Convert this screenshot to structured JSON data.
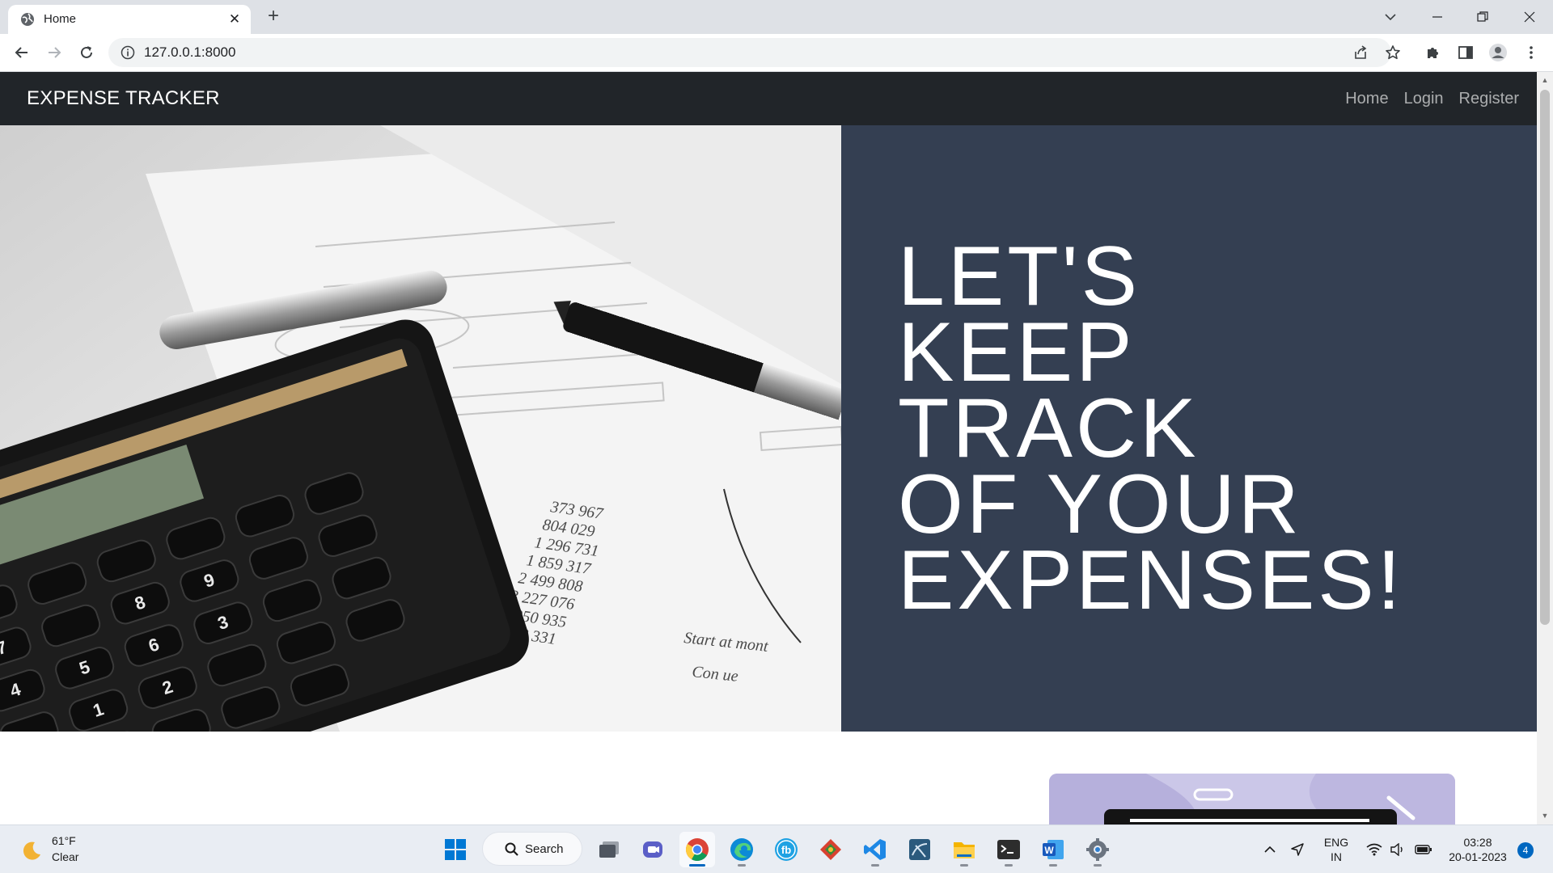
{
  "browser": {
    "tab": {
      "title": "Home",
      "close_glyph": "✕"
    },
    "new_tab_glyph": "+",
    "address_bar": {
      "url": "127.0.0.1:8000"
    }
  },
  "site": {
    "brand": "EXPENSE TRACKER",
    "nav": {
      "links": [
        {
          "label": "Home"
        },
        {
          "label": "Login"
        },
        {
          "label": "Register"
        }
      ]
    },
    "hero": {
      "heading_lines": [
        "LET'S",
        "KEEP",
        "TRACK",
        "OF YOUR",
        "EXPENSES!"
      ],
      "image_icon": "calculator-and-financial-papers-photo"
    }
  },
  "taskbar": {
    "weather": {
      "temperature": "61°F",
      "condition": "Clear",
      "icon": "moon-icon"
    },
    "search_label": "Search",
    "tray": {
      "language": "ENG",
      "region": "IN",
      "time": "03:28",
      "date": "20-01-2023",
      "notification_count": "4"
    }
  },
  "colors": {
    "navbar_bg": "#212529",
    "hero_panel_bg": "#343f52",
    "accent_blue": "#0067c0"
  }
}
